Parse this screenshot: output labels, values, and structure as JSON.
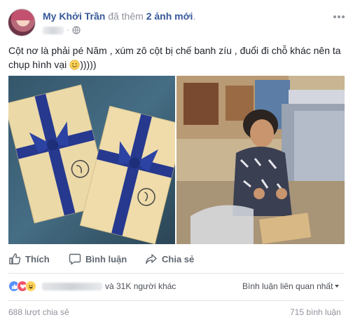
{
  "post": {
    "author": "My Khởi Trần",
    "action_prefix": "đã thêm",
    "action_highlight": "2 ảnh mới",
    "action_suffix": ".",
    "text": "Cột nơ là phải pé Năm , xúm zô cột bị chế banh zíu , đuổi đi chỗ khác nên ta chụp hình vại",
    "text_tail": ")))))"
  },
  "actions": {
    "like": "Thích",
    "comment": "Bình luận",
    "share": "Chia sẻ"
  },
  "reactions": {
    "icons": [
      "like-icon",
      "love-icon",
      "haha-icon"
    ],
    "others_text": "và 31K người khác"
  },
  "comments_sort": {
    "label": "Bình luận liên quan nhất"
  },
  "counts": {
    "shares": "688 lượt chia sẻ",
    "comments": "715 bình luận"
  },
  "colors": {
    "link": "#365899",
    "muted": "#90949c",
    "like_blue": "#5890ff",
    "love_red": "#f25268",
    "haha_yellow": "#fcd35a"
  }
}
